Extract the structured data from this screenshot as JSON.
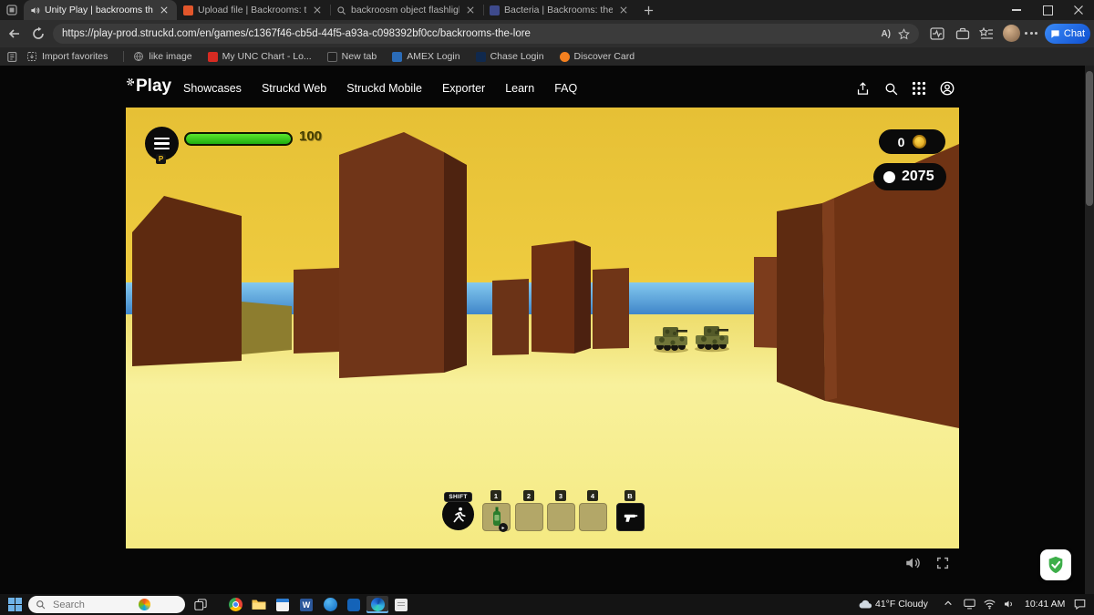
{
  "browser": {
    "tabs": [
      {
        "title": "Unity Play | backrooms the l"
      },
      {
        "title": "Upload file | Backrooms: the lore"
      },
      {
        "title": "backroosm object flashlights - Sa"
      },
      {
        "title": "Bacteria | Backrooms: the lore Wi"
      }
    ],
    "url": "https://play-prod.struckd.com/en/games/c1367f46-cb5d-44f5-a93a-c098392bf0cc/backrooms-the-lore",
    "read_aloud": "A)",
    "chat_label": "Chat",
    "favorites": [
      "Import favorites",
      "like image",
      "My UNC Chart - Lo...",
      "New tab",
      "AMEX Login",
      "Chase Login",
      "Discover Card"
    ]
  },
  "site": {
    "logo_text": "Play",
    "nav": [
      "Showcases",
      "Struckd Web",
      "Struckd Mobile",
      "Exporter",
      "Learn",
      "FAQ"
    ]
  },
  "game": {
    "health_value": "100",
    "coin_count": "0",
    "score": "2075",
    "player_badge": "P",
    "shift_label": "SHIFT",
    "hotbar": {
      "keys": [
        "1",
        "2",
        "3",
        "4",
        "B"
      ]
    }
  },
  "taskbar": {
    "search_placeholder": "Search",
    "weather": "41°F Cloudy",
    "time": "10:41 AM"
  },
  "colors": {
    "accent_blue": "#1f6df2",
    "health_green": "#2ecc1e",
    "coin_gold": "#e8b92a",
    "shield_green": "#3dae49",
    "sky_yellow": "#eec93e",
    "building_brown": "#6e3418"
  }
}
